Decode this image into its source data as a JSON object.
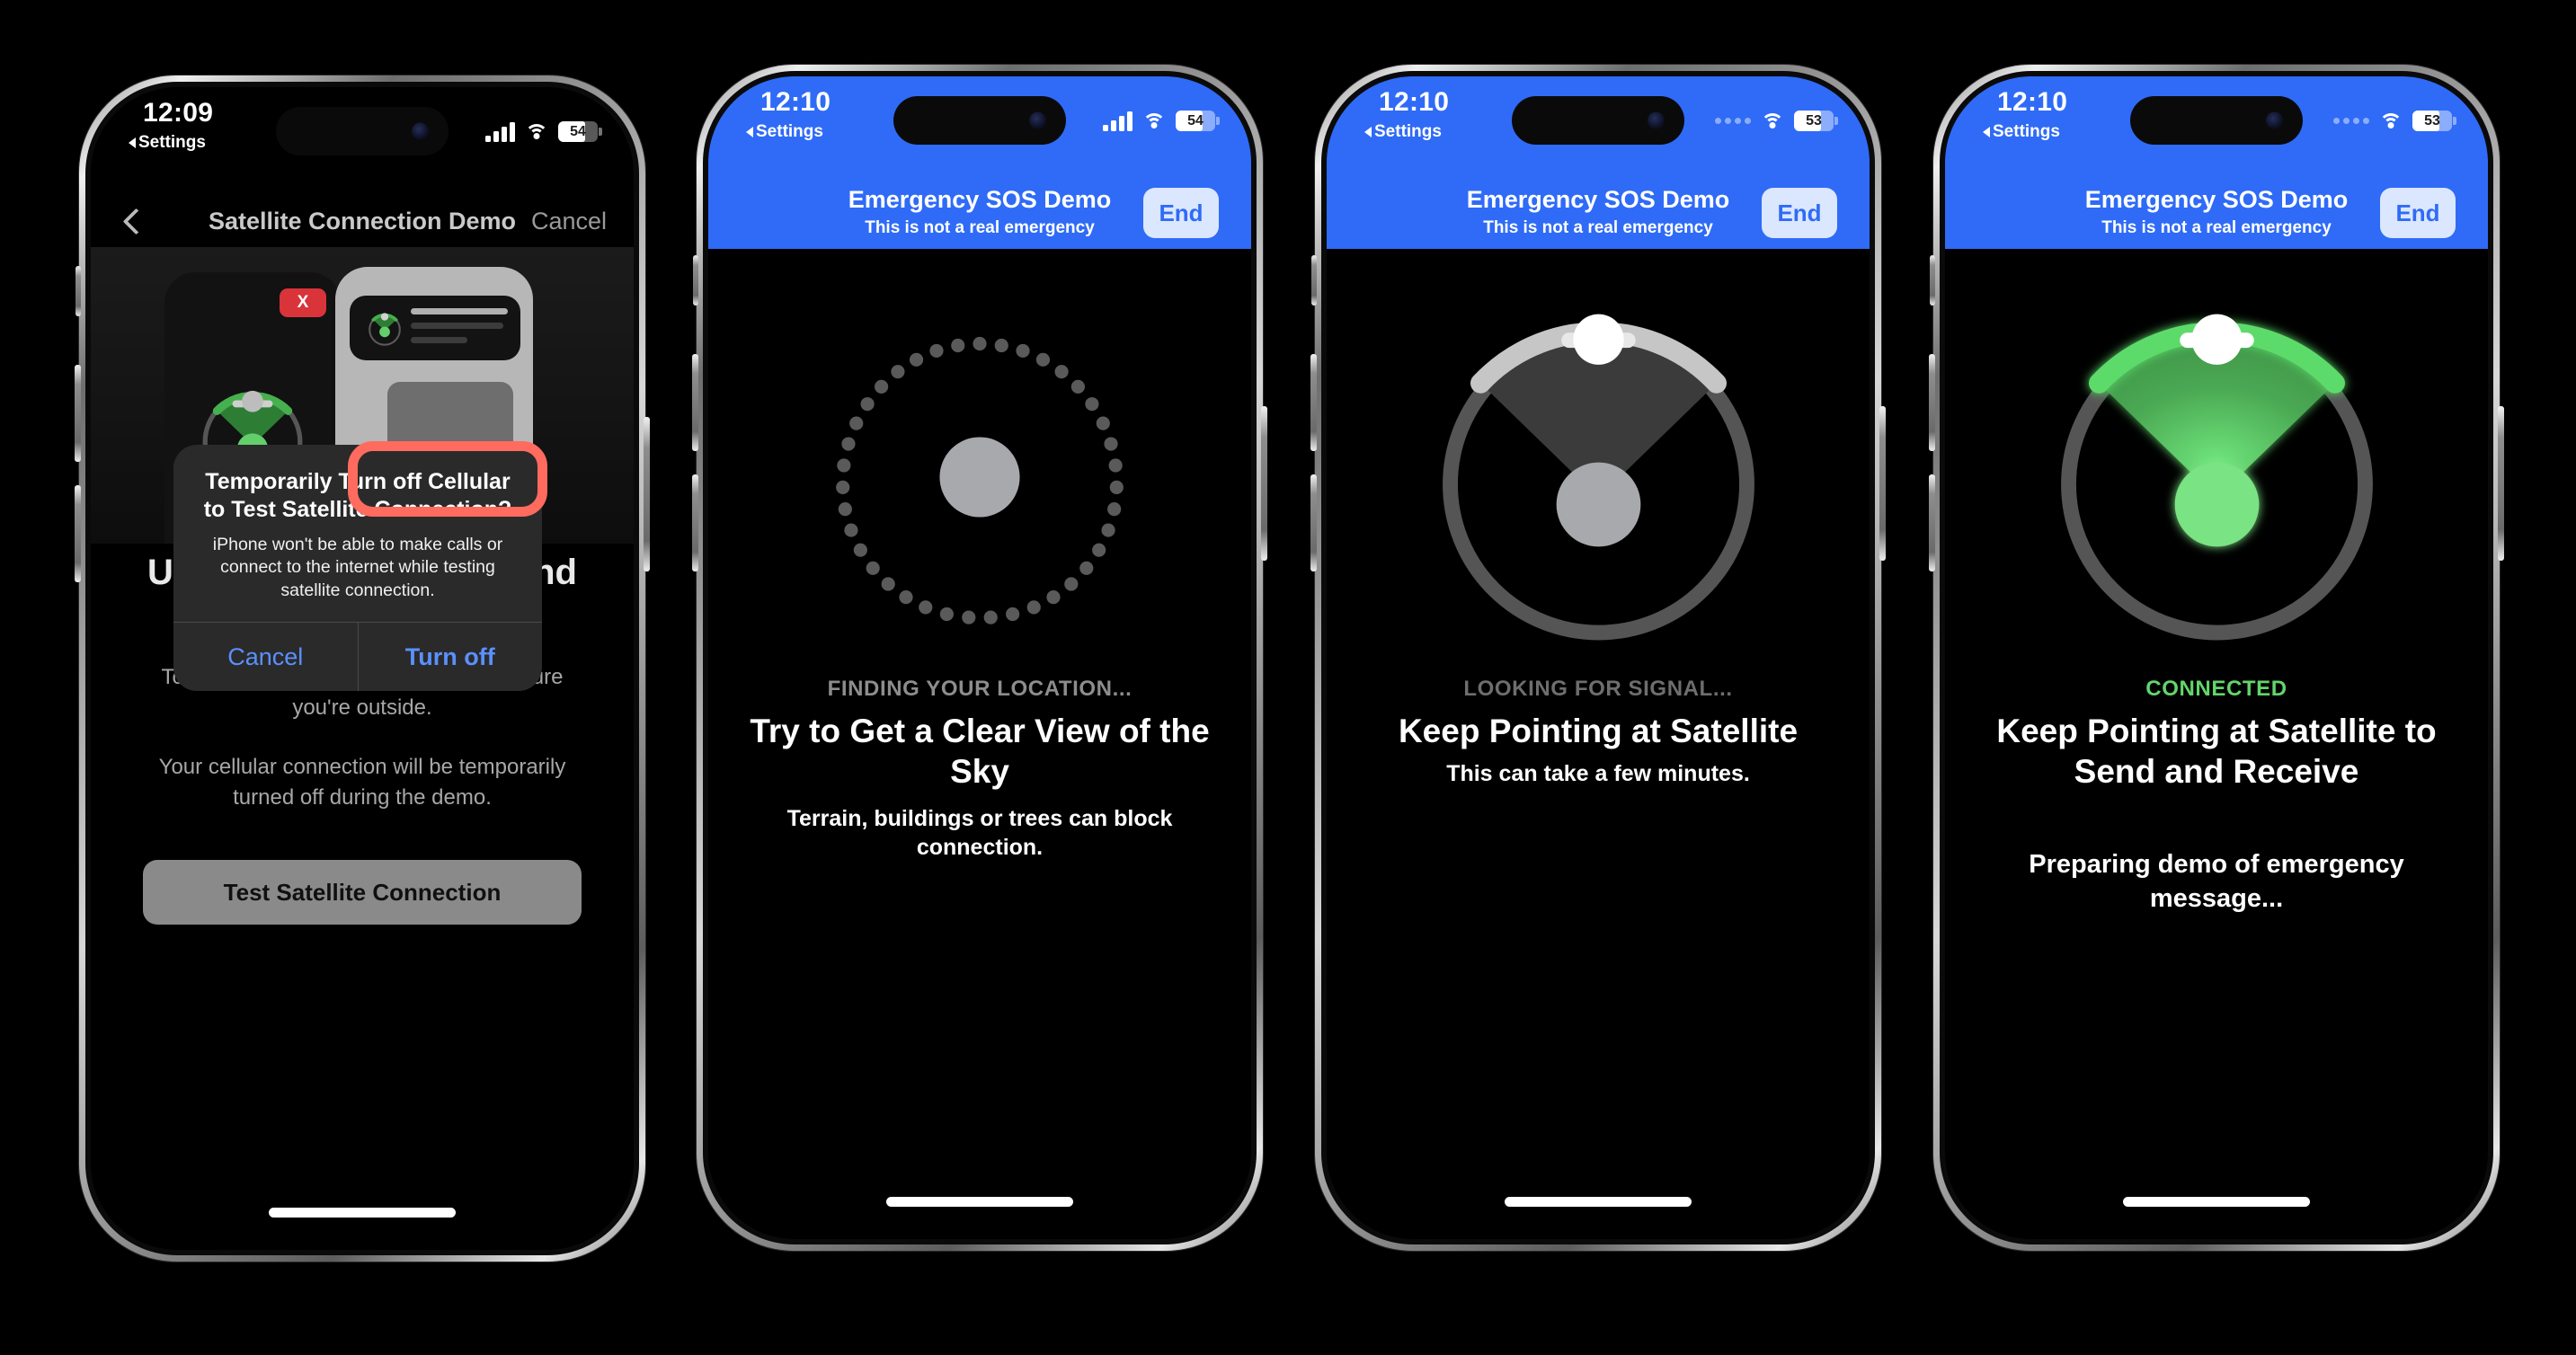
{
  "phones": [
    {
      "id": "phone-satellite-demo-alert",
      "statusbar": {
        "time": "12:09",
        "back_label": "Settings",
        "signal": "bars",
        "wifi": "wifi-icon",
        "battery": "54",
        "style": "dark"
      },
      "navbar": {
        "back": "chevron-left-icon",
        "title": "Satellite Connection Demo",
        "cancel": "Cancel"
      },
      "hero": {
        "close_badge": "X",
        "send_icon": "↑"
      },
      "headline": "Use Satellite to Send and Receive Messages",
      "paragraphs": [
        "To test the satellite connection, make sure you're outside.",
        "Your cellular connection will be temporarily turned off during the demo."
      ],
      "primary_button": "Test Satellite Connection",
      "alert": {
        "title": "Temporarily Turn off Cellular to Test Satellite Connection?",
        "message": "iPhone won't be able to make calls or connect to the internet while testing satellite connection.",
        "cancel_label": "Cancel",
        "confirm_label": "Turn off",
        "highlight_color": "#ff6b5e"
      }
    },
    {
      "id": "phone-finding-location",
      "statusbar": {
        "time": "12:10",
        "back_label": "Settings",
        "signal": "bars",
        "wifi": "wifi-icon",
        "battery": "54",
        "style": "blue"
      },
      "sos_header": {
        "title": "Emergency SOS Demo",
        "subtitle": "This is not a real emergency",
        "end_label": "End"
      },
      "graphic": "dotted-circle-searching",
      "status_caption": "FINDING YOUR LOCATION...",
      "status_caption_color": "#8d8d8d",
      "headline": "Try to Get a Clear View of the Sky",
      "subtext": "Terrain, buildings or trees can block connection."
    },
    {
      "id": "phone-looking-for-signal",
      "statusbar": {
        "time": "12:10",
        "back_label": "Settings",
        "signal": "dots",
        "wifi": "wifi-icon",
        "battery": "53",
        "style": "blue"
      },
      "sos_header": {
        "title": "Emergency SOS Demo",
        "subtitle": "This is not a real emergency",
        "end_label": "End"
      },
      "graphic": "satellite-cone-grey",
      "status_caption": "LOOKING FOR SIGNAL...",
      "status_caption_color": "#6e6e6e",
      "headline": "Keep Pointing at Satellite",
      "subtext": "This can take a few minutes."
    },
    {
      "id": "phone-connected",
      "statusbar": {
        "time": "12:10",
        "back_label": "Settings",
        "signal": "dots",
        "wifi": "wifi-icon",
        "battery": "53",
        "style": "blue"
      },
      "sos_header": {
        "title": "Emergency SOS Demo",
        "subtitle": "This is not a real emergency",
        "end_label": "End"
      },
      "graphic": "satellite-cone-green",
      "status_caption": "CONNECTED",
      "status_caption_color": "#63d56a",
      "headline": "Keep Pointing at Satellite to Send and Receive",
      "subtext": "",
      "footer_text": "Preparing demo of emergency message..."
    }
  ],
  "colors": {
    "sos_blue": "#2f6bf7",
    "alert_blue": "#5b90ff",
    "connected_green": "#63d56a",
    "cone_green": "#5ddb6a",
    "highlight_red": "#ff6b5e",
    "background": "#000000"
  }
}
